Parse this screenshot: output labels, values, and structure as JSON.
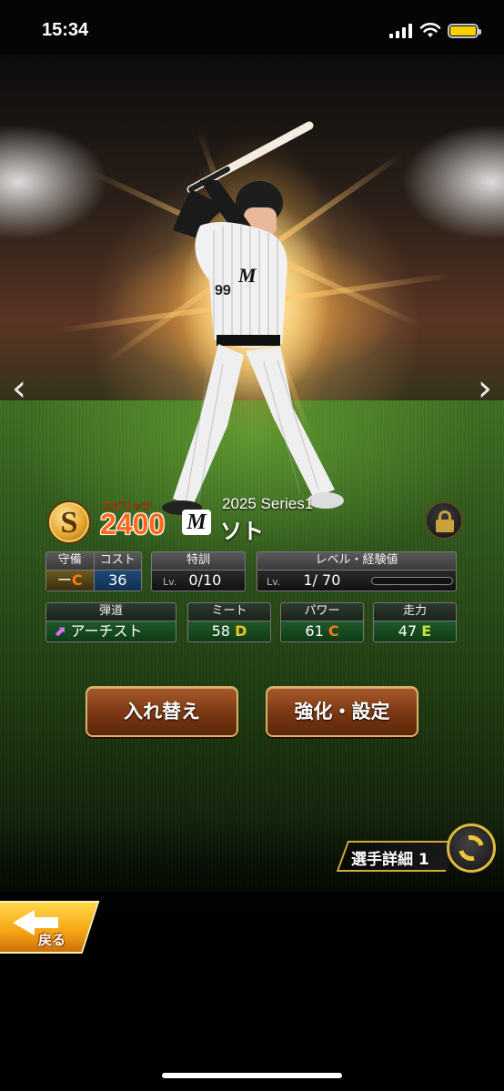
{
  "status_bar": {
    "time": "15:34"
  },
  "card": {
    "rank": "S",
    "spirits_label": "スピリッツ",
    "spirits_value": "2400",
    "team_logo": "M",
    "series": "2025 Series1",
    "player_name": "ソト",
    "jersey_number": "99",
    "locked": true
  },
  "stats_row1": {
    "defense": {
      "header": "守備",
      "value": "ー",
      "grade": "C"
    },
    "cost": {
      "header": "コスト",
      "value": "36"
    },
    "training": {
      "header": "特訓",
      "lv_label": "Lv.",
      "value": "0/10"
    },
    "level": {
      "header": "レベル・経験値",
      "lv_label": "Lv.",
      "value": "1/ 70",
      "exp_progress": 0.0
    }
  },
  "stats_row2": {
    "trajectory": {
      "header": "弾道",
      "value": "アーチスト"
    },
    "meet": {
      "header": "ミート",
      "value": "58",
      "grade": "D"
    },
    "power": {
      "header": "パワー",
      "value": "61",
      "grade": "C"
    },
    "speed": {
      "header": "走力",
      "value": "47",
      "grade": "E"
    }
  },
  "buttons": {
    "replace": "入れ替え",
    "enhance": "強化・設定",
    "detail": "選手詳細 1",
    "back": "戻る"
  },
  "colors": {
    "grade_c": "#ff7a1a",
    "grade_d": "#f2c21a",
    "grade_e": "#c6e03a",
    "button_border": "#d8b36a",
    "back_button": "#f6a313"
  }
}
